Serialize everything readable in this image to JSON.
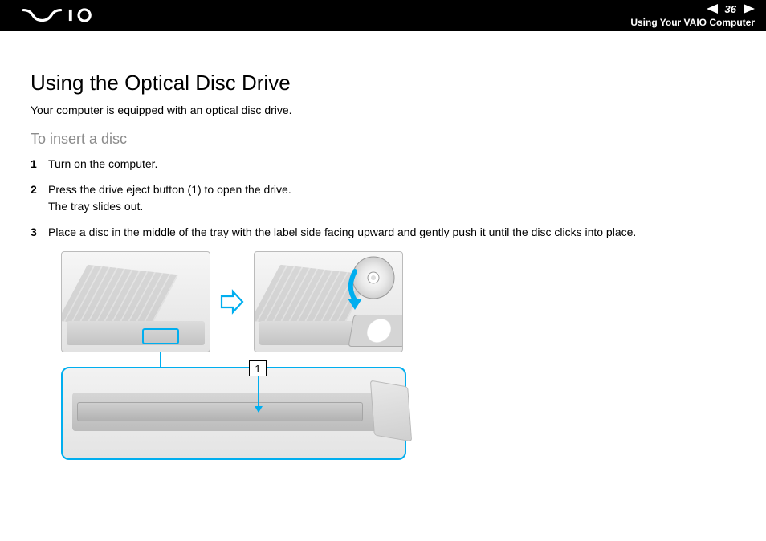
{
  "header": {
    "brand": "VAIO",
    "page_number": "36",
    "section_title": "Using Your VAIO Computer"
  },
  "content": {
    "title": "Using the Optical Disc Drive",
    "intro": "Your computer is equipped with an optical disc drive.",
    "subtitle": "To insert a disc",
    "steps": [
      {
        "num": "1",
        "text": "Turn on the computer."
      },
      {
        "num": "2",
        "text": "Press the drive eject button (1) to open the drive.\nThe tray slides out."
      },
      {
        "num": "3",
        "text": "Place a disc in the middle of the tray with the label side facing upward and gently push it until the disc clicks into place."
      }
    ],
    "callout_label": "1"
  },
  "colors": {
    "accent": "#00aeef"
  }
}
